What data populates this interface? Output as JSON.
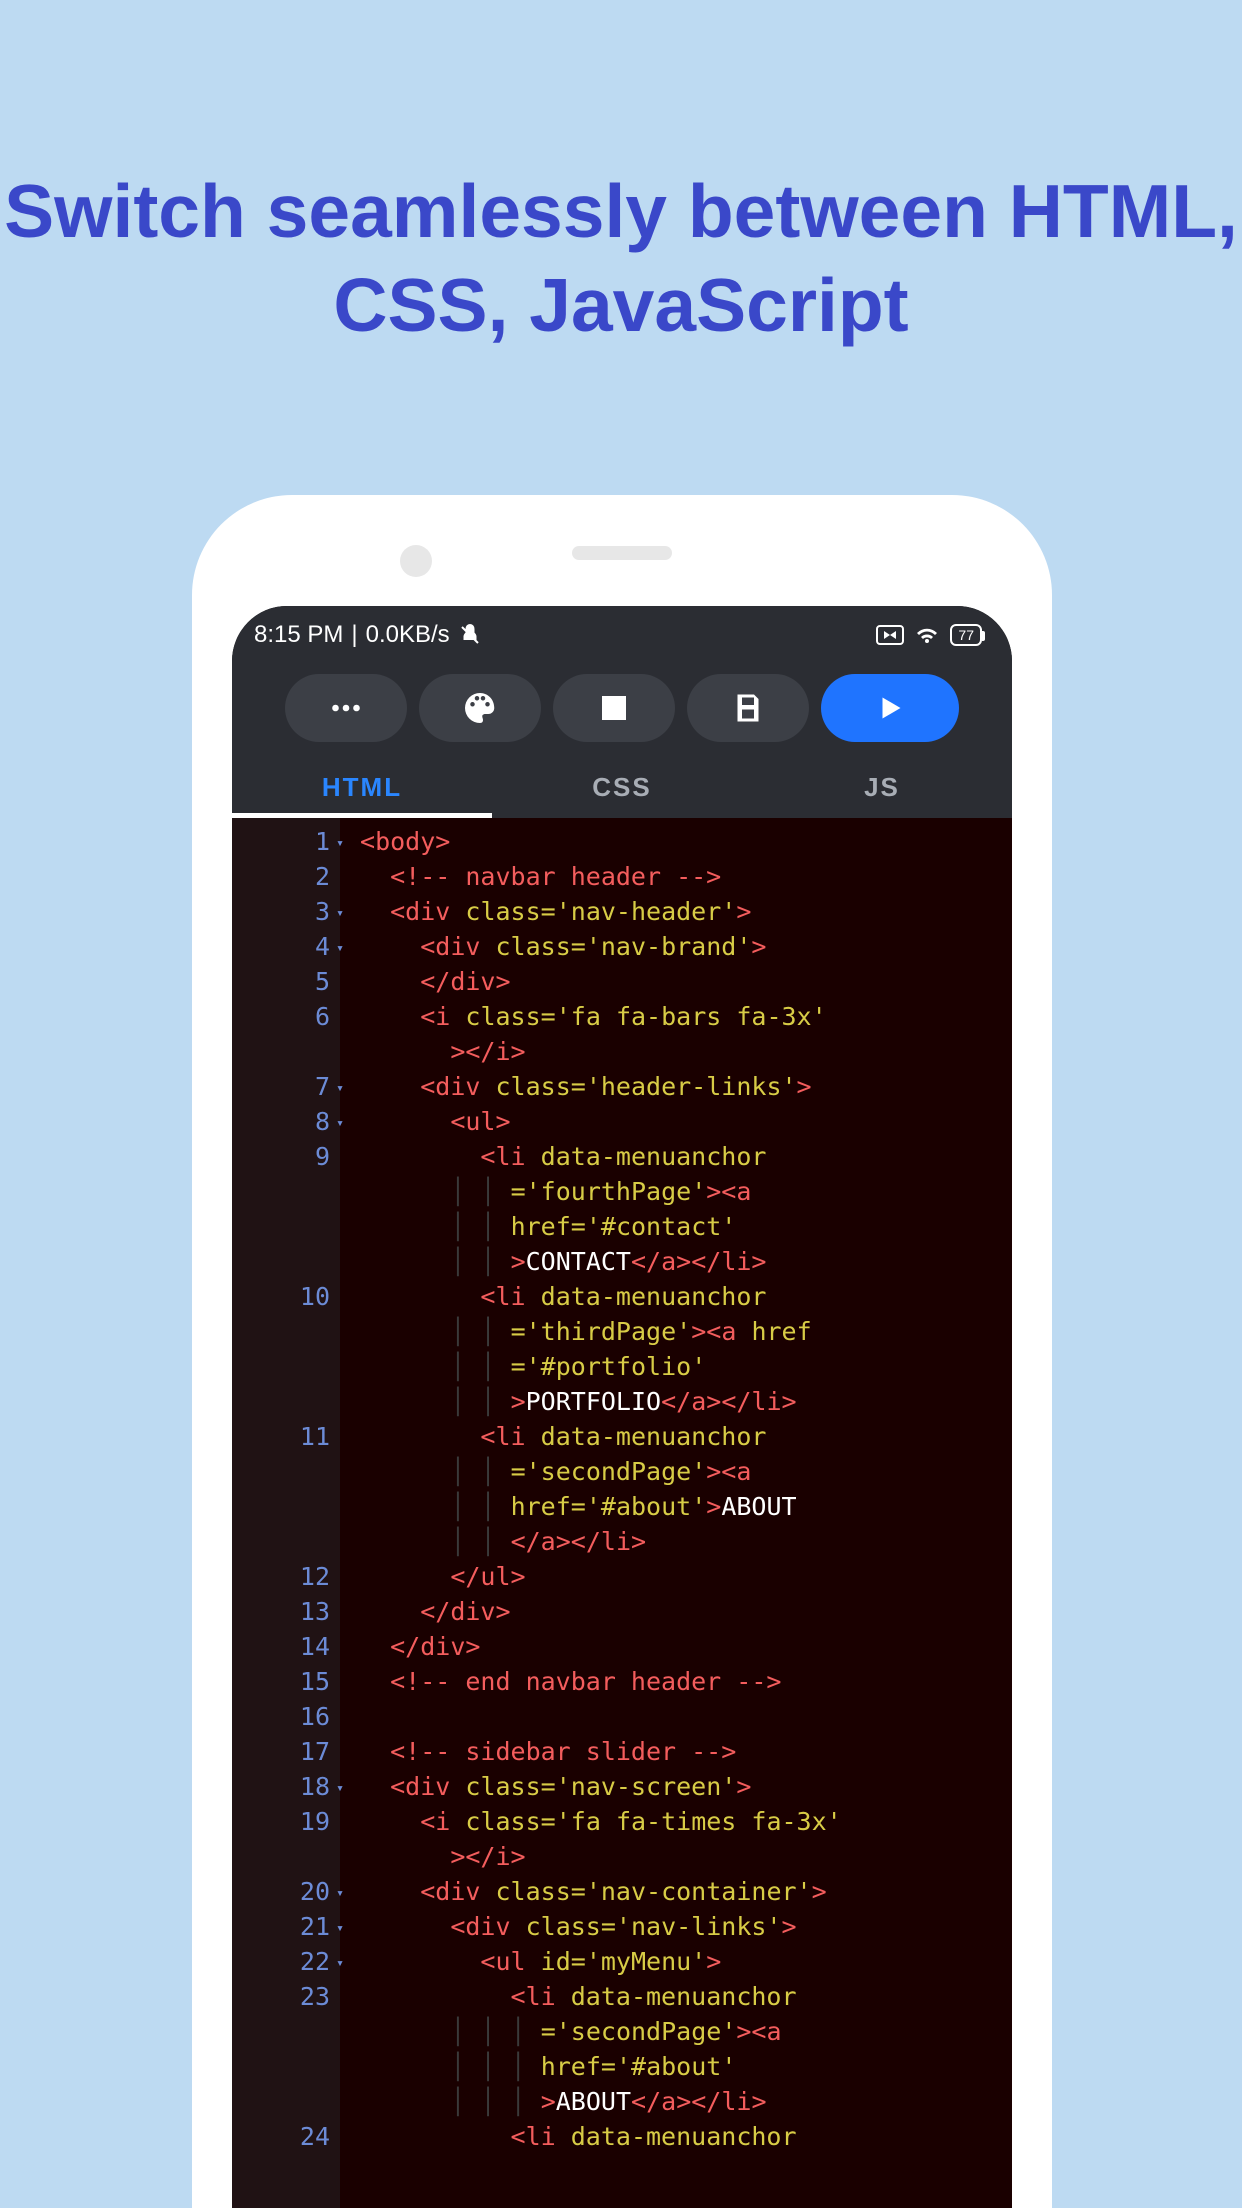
{
  "headline": "Switch seamlessly between HTML, CSS, JavaScript",
  "status": {
    "time": "8:15 PM",
    "sep": "|",
    "speed": "0.0KB/s",
    "battery": "77"
  },
  "tabs": {
    "html": "HTML",
    "css": "CSS",
    "js": "JS"
  },
  "code": {
    "lines": [
      {
        "n": 1,
        "fold": true,
        "info": true,
        "indent": 0,
        "tokens": [
          [
            "punc",
            "<"
          ],
          [
            "tag",
            "body"
          ],
          [
            "punc",
            ">"
          ]
        ]
      },
      {
        "n": 2,
        "indent": 1,
        "tokens": [
          [
            "cmt",
            "<!-- navbar header -->"
          ]
        ]
      },
      {
        "n": 3,
        "fold": true,
        "indent": 1,
        "tokens": [
          [
            "punc",
            "<"
          ],
          [
            "tag",
            "div"
          ],
          [
            "txt",
            " "
          ],
          [
            "attr",
            "class"
          ],
          [
            "eq",
            "="
          ],
          [
            "str",
            "'nav-header'"
          ],
          [
            "punc",
            ">"
          ]
        ]
      },
      {
        "n": 4,
        "fold": true,
        "indent": 2,
        "tokens": [
          [
            "punc",
            "<"
          ],
          [
            "tag",
            "div"
          ],
          [
            "txt",
            " "
          ],
          [
            "attr",
            "class"
          ],
          [
            "eq",
            "="
          ],
          [
            "str",
            "'nav-brand'"
          ],
          [
            "punc",
            ">"
          ]
        ]
      },
      {
        "n": 5,
        "indent": 2,
        "tokens": [
          [
            "punc",
            "</"
          ],
          [
            "tag",
            "div"
          ],
          [
            "punc",
            ">"
          ]
        ]
      },
      {
        "n": 6,
        "indent": 2,
        "tokens": [
          [
            "punc",
            "<"
          ],
          [
            "tag",
            "i"
          ],
          [
            "txt",
            " "
          ],
          [
            "attr",
            "class"
          ],
          [
            "eq",
            "="
          ],
          [
            "str",
            "'fa fa-bars fa-3x'"
          ]
        ]
      },
      {
        "n": "",
        "indent": 3,
        "cont": true,
        "tokens": [
          [
            "punc",
            "></"
          ],
          [
            "tag",
            "i"
          ],
          [
            "punc",
            ">"
          ]
        ]
      },
      {
        "n": 7,
        "fold": true,
        "indent": 2,
        "tokens": [
          [
            "punc",
            "<"
          ],
          [
            "tag",
            "div"
          ],
          [
            "txt",
            " "
          ],
          [
            "attr",
            "class"
          ],
          [
            "eq",
            "="
          ],
          [
            "str",
            "'header-links'"
          ],
          [
            "punc",
            ">"
          ]
        ]
      },
      {
        "n": 8,
        "fold": true,
        "indent": 3,
        "tokens": [
          [
            "punc",
            "<"
          ],
          [
            "tag",
            "ul"
          ],
          [
            "punc",
            ">"
          ]
        ]
      },
      {
        "n": 9,
        "indent": 4,
        "tokens": [
          [
            "punc",
            "<"
          ],
          [
            "tag",
            "li"
          ],
          [
            "txt",
            " "
          ],
          [
            "attr",
            "data-menuanchor"
          ]
        ]
      },
      {
        "n": "",
        "indent": 5,
        "cont": true,
        "tokens": [
          [
            "eq",
            "="
          ],
          [
            "str",
            "'fourthPage'"
          ],
          [
            "punc",
            "><"
          ],
          [
            "tag",
            "a"
          ]
        ]
      },
      {
        "n": "",
        "indent": 5,
        "cont": true,
        "tokens": [
          [
            "attr",
            "href"
          ],
          [
            "eq",
            "="
          ],
          [
            "str",
            "'#contact'"
          ]
        ]
      },
      {
        "n": "",
        "indent": 5,
        "cont": true,
        "tokens": [
          [
            "punc",
            ">"
          ],
          [
            "txt",
            "CONTACT"
          ],
          [
            "punc",
            "</"
          ],
          [
            "tag",
            "a"
          ],
          [
            "punc",
            "></"
          ],
          [
            "tag",
            "li"
          ],
          [
            "punc",
            ">"
          ]
        ]
      },
      {
        "n": 10,
        "indent": 4,
        "tokens": [
          [
            "punc",
            "<"
          ],
          [
            "tag",
            "li"
          ],
          [
            "txt",
            " "
          ],
          [
            "attr",
            "data-menuanchor"
          ]
        ]
      },
      {
        "n": "",
        "indent": 5,
        "cont": true,
        "tokens": [
          [
            "eq",
            "="
          ],
          [
            "str",
            "'thirdPage'"
          ],
          [
            "punc",
            "><"
          ],
          [
            "tag",
            "a"
          ],
          [
            "txt",
            " "
          ],
          [
            "attr",
            "href"
          ]
        ]
      },
      {
        "n": "",
        "indent": 5,
        "cont": true,
        "tokens": [
          [
            "eq",
            "="
          ],
          [
            "str",
            "'#portfolio'"
          ]
        ]
      },
      {
        "n": "",
        "indent": 5,
        "cont": true,
        "tokens": [
          [
            "punc",
            ">"
          ],
          [
            "txt",
            "PORTFOLIO"
          ],
          [
            "punc",
            "</"
          ],
          [
            "tag",
            "a"
          ],
          [
            "punc",
            "></"
          ],
          [
            "tag",
            "li"
          ],
          [
            "punc",
            ">"
          ]
        ]
      },
      {
        "n": 11,
        "indent": 4,
        "tokens": [
          [
            "punc",
            "<"
          ],
          [
            "tag",
            "li"
          ],
          [
            "txt",
            " "
          ],
          [
            "attr",
            "data-menuanchor"
          ]
        ]
      },
      {
        "n": "",
        "indent": 5,
        "cont": true,
        "tokens": [
          [
            "eq",
            "="
          ],
          [
            "str",
            "'secondPage'"
          ],
          [
            "punc",
            "><"
          ],
          [
            "tag",
            "a"
          ]
        ]
      },
      {
        "n": "",
        "indent": 5,
        "cont": true,
        "tokens": [
          [
            "attr",
            "href"
          ],
          [
            "eq",
            "="
          ],
          [
            "str",
            "'#about'"
          ],
          [
            "punc",
            ">"
          ],
          [
            "txt",
            "ABOUT"
          ]
        ]
      },
      {
        "n": "",
        "indent": 5,
        "cont": true,
        "tokens": [
          [
            "punc",
            "</"
          ],
          [
            "tag",
            "a"
          ],
          [
            "punc",
            "></"
          ],
          [
            "tag",
            "li"
          ],
          [
            "punc",
            ">"
          ]
        ]
      },
      {
        "n": 12,
        "indent": 3,
        "tokens": [
          [
            "punc",
            "</"
          ],
          [
            "tag",
            "ul"
          ],
          [
            "punc",
            ">"
          ]
        ]
      },
      {
        "n": 13,
        "indent": 2,
        "tokens": [
          [
            "punc",
            "</"
          ],
          [
            "tag",
            "div"
          ],
          [
            "punc",
            ">"
          ]
        ]
      },
      {
        "n": 14,
        "indent": 1,
        "tokens": [
          [
            "punc",
            "</"
          ],
          [
            "tag",
            "div"
          ],
          [
            "punc",
            ">"
          ]
        ]
      },
      {
        "n": 15,
        "indent": 1,
        "tokens": [
          [
            "cmt",
            "<!-- end navbar header -->"
          ]
        ]
      },
      {
        "n": 16,
        "indent": 1,
        "tokens": []
      },
      {
        "n": 17,
        "indent": 1,
        "tokens": [
          [
            "cmt",
            "<!-- sidebar slider -->"
          ]
        ]
      },
      {
        "n": 18,
        "fold": true,
        "indent": 1,
        "tokens": [
          [
            "punc",
            "<"
          ],
          [
            "tag",
            "div"
          ],
          [
            "txt",
            " "
          ],
          [
            "attr",
            "class"
          ],
          [
            "eq",
            "="
          ],
          [
            "str",
            "'nav-screen'"
          ],
          [
            "punc",
            ">"
          ]
        ]
      },
      {
        "n": 19,
        "indent": 2,
        "tokens": [
          [
            "punc",
            "<"
          ],
          [
            "tag",
            "i"
          ],
          [
            "txt",
            " "
          ],
          [
            "attr",
            "class"
          ],
          [
            "eq",
            "="
          ],
          [
            "str",
            "'fa fa-times fa-3x'"
          ]
        ]
      },
      {
        "n": "",
        "indent": 3,
        "cont": true,
        "tokens": [
          [
            "punc",
            "></"
          ],
          [
            "tag",
            "i"
          ],
          [
            "punc",
            ">"
          ]
        ]
      },
      {
        "n": 20,
        "fold": true,
        "indent": 2,
        "tokens": [
          [
            "punc",
            "<"
          ],
          [
            "tag",
            "div"
          ],
          [
            "txt",
            " "
          ],
          [
            "attr",
            "class"
          ],
          [
            "eq",
            "="
          ],
          [
            "str",
            "'nav-container'"
          ],
          [
            "punc",
            ">"
          ]
        ]
      },
      {
        "n": 21,
        "fold": true,
        "indent": 3,
        "tokens": [
          [
            "punc",
            "<"
          ],
          [
            "tag",
            "div"
          ],
          [
            "txt",
            " "
          ],
          [
            "attr",
            "class"
          ],
          [
            "eq",
            "="
          ],
          [
            "str",
            "'nav-links'"
          ],
          [
            "punc",
            ">"
          ]
        ]
      },
      {
        "n": 22,
        "fold": true,
        "indent": 4,
        "tokens": [
          [
            "punc",
            "<"
          ],
          [
            "tag",
            "ul"
          ],
          [
            "txt",
            " "
          ],
          [
            "attr",
            "id"
          ],
          [
            "eq",
            "="
          ],
          [
            "str",
            "'myMenu'"
          ],
          [
            "punc",
            ">"
          ]
        ]
      },
      {
        "n": 23,
        "indent": 5,
        "tokens": [
          [
            "punc",
            "<"
          ],
          [
            "tag",
            "li"
          ],
          [
            "txt",
            " "
          ],
          [
            "attr",
            "data-menuanchor"
          ]
        ]
      },
      {
        "n": "",
        "indent": 6,
        "cont": true,
        "tokens": [
          [
            "eq",
            "="
          ],
          [
            "str",
            "'secondPage'"
          ],
          [
            "punc",
            "><"
          ],
          [
            "tag",
            "a"
          ]
        ]
      },
      {
        "n": "",
        "indent": 6,
        "cont": true,
        "tokens": [
          [
            "attr",
            "href"
          ],
          [
            "eq",
            "="
          ],
          [
            "str",
            "'#about'"
          ]
        ]
      },
      {
        "n": "",
        "indent": 6,
        "cont": true,
        "tokens": [
          [
            "punc",
            ">"
          ],
          [
            "txt",
            "ABOUT"
          ],
          [
            "punc",
            "</"
          ],
          [
            "tag",
            "a"
          ],
          [
            "punc",
            "></"
          ],
          [
            "tag",
            "li"
          ],
          [
            "punc",
            ">"
          ]
        ]
      },
      {
        "n": 24,
        "indent": 5,
        "tokens": [
          [
            "punc",
            "<"
          ],
          [
            "tag",
            "li"
          ],
          [
            "txt",
            " "
          ],
          [
            "attr",
            "data-menuanchor"
          ]
        ]
      }
    ]
  }
}
